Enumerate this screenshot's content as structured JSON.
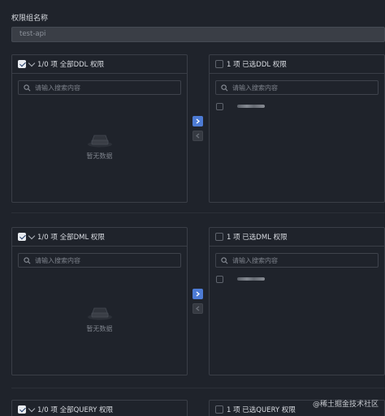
{
  "form": {
    "group_name_label": "权限组名称",
    "group_name_value": "test-api"
  },
  "search_placeholder": "请输入搜索内容",
  "empty_text": "暂无数据",
  "transfers": [
    {
      "left_header": "1/0 项 全部DDL 权限",
      "right_header": "1 项 已选DDL 权限",
      "right_items": [
        ""
      ]
    },
    {
      "left_header": "1/0 项 全部DML 权限",
      "right_header": "1 项 已选DML 权限",
      "right_items": [
        ""
      ]
    },
    {
      "left_header": "1/0 项 全部QUERY 权限",
      "right_header": "1 项 已选QUERY 权限",
      "right_items": []
    }
  ],
  "watermark": "@稀土掘金技术社区",
  "colors": {
    "accent": "#4d7bd4",
    "background": "#1f232b",
    "border": "#3a3e47"
  }
}
